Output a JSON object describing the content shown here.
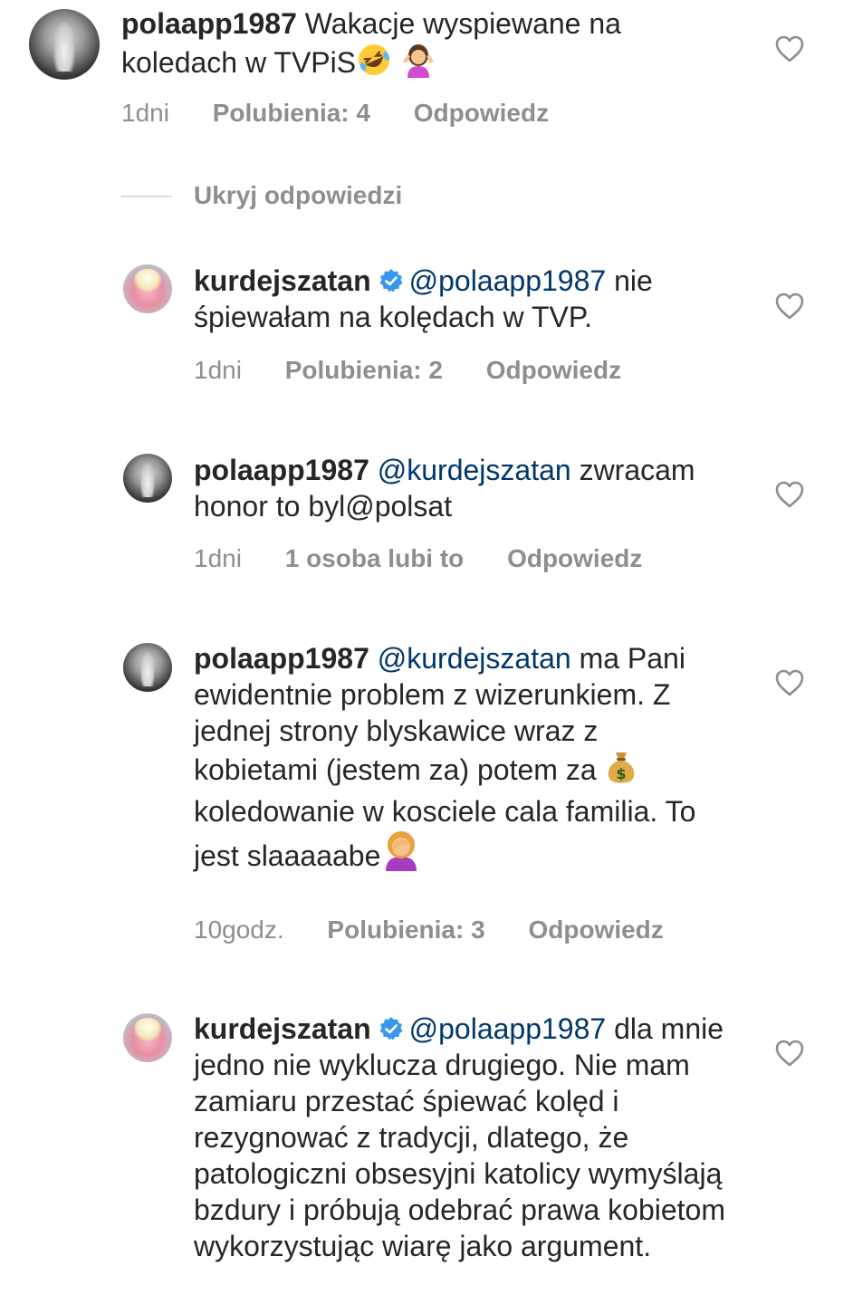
{
  "comments": [
    {
      "username": "polaapp1987",
      "verified": false,
      "mention": "",
      "text": "Wakacje wyspiewane na koledach w TVPiS",
      "emojis": [
        "rolling-on-floor-laughing-emoji",
        "person-shrugging-emoji"
      ],
      "time": "1dni",
      "likes": "Polubienia: 4",
      "reply": "Odpowiedz"
    },
    {
      "username": "kurdejszatan",
      "verified": true,
      "mention": "@polaapp1987",
      "text": " nie śpiewałam na kolędach w TVP.",
      "time": "1dni",
      "likes": "Polubienia: 2",
      "reply": "Odpowiedz"
    },
    {
      "username": "polaapp1987",
      "verified": false,
      "mention": "@kurdejszatan",
      "text": " zwracam honor to byl@polsat",
      "time": "1dni",
      "likes": "1 osoba lubi to",
      "reply": "Odpowiedz"
    },
    {
      "username": "polaapp1987",
      "verified": false,
      "mention": "@kurdejszatan",
      "text_a": " ma Pani ewidentnie problem z wizerunkiem. Z jednej strony blyskawice wraz z kobietami (jestem za) potem za ",
      "text_b": " koledowanie w kosciele cala familia. To jest slaaaaabe",
      "emojis": [
        "money-bag-emoji",
        "person-facepalming-emoji"
      ],
      "time": "10godz.",
      "likes": "Polubienia: 3",
      "reply": "Odpowiedz"
    },
    {
      "username": "kurdejszatan",
      "verified": true,
      "mention": "@polaapp1987",
      "text": " dla mnie jedno nie wyklucza drugiego. Nie mam zamiaru przestać śpiewać kolęd i rezygnować z tradycji, dlatego, że patologiczni obsesyjni katolicy wymyślają bzdury i próbują odebrać prawa kobietom wykorzystując wiarę jako argument."
    }
  ],
  "hide_replies_label": "Ukryj odpowiedzi",
  "colors": {
    "text": "#262626",
    "mention": "#00376b",
    "meta": "#8e8e8e",
    "verified": "#3897f0"
  },
  "icons": {
    "like": "heart-outline-icon",
    "verified": "verified-badge-icon"
  }
}
